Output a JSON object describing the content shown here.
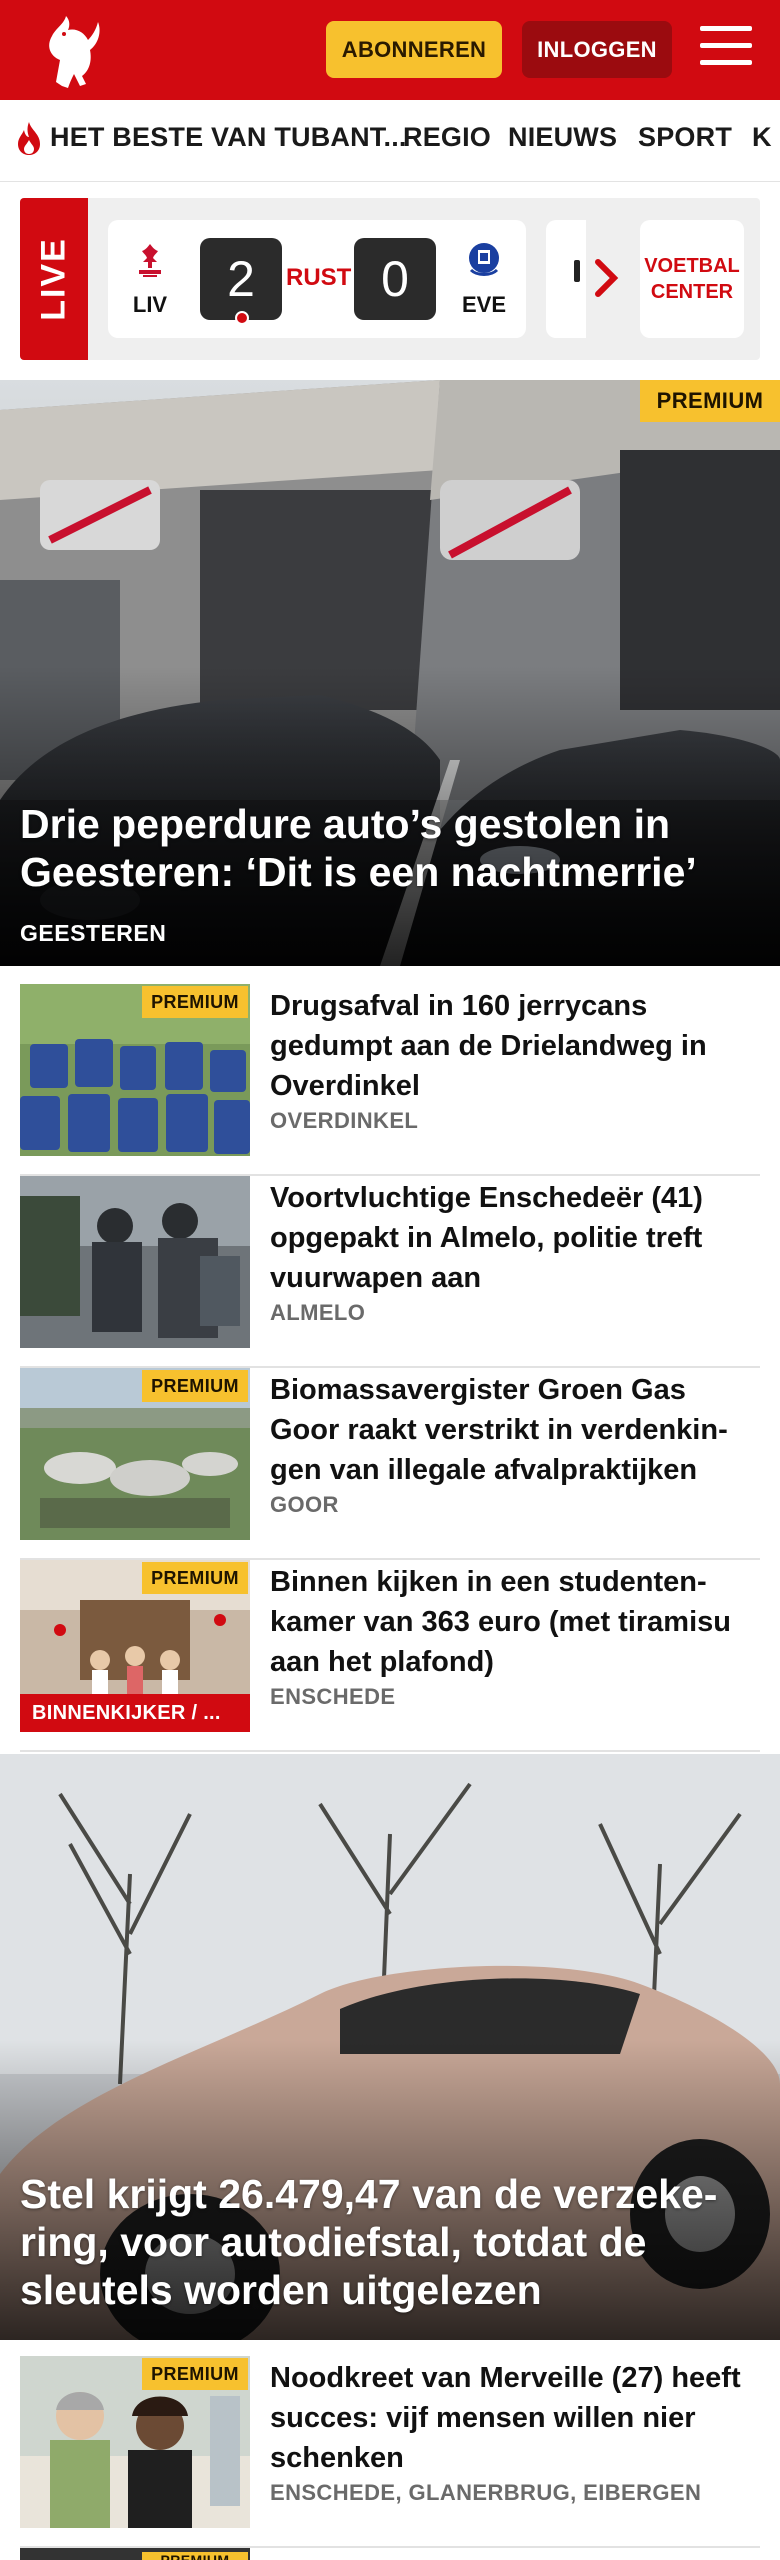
{
  "header": {
    "subscribe_label": "ABONNEREN",
    "login_label": "INLOGGEN",
    "brand_color": "#d10a11",
    "accent_color": "#f7c12e"
  },
  "nav": {
    "items": [
      "HET BESTE VAN TUBANT...",
      "REGIO",
      "NIEUWS",
      "SPORT",
      "K"
    ]
  },
  "live": {
    "label": "LIVE",
    "match": {
      "home": "LIV",
      "home_score": "2",
      "status": "RUST",
      "away_score": "0",
      "away": "EVE"
    },
    "voetbal_center": "VOETBAL CENTER"
  },
  "hero": {
    "badge": "PREMIUM",
    "title": "Drie peperdure auto’s gestolen in Geesteren: ‘Dit is een nachtmerrie’",
    "location": "GEESTEREN"
  },
  "articles": [
    {
      "premium": "PREMIUM",
      "title": "Drugsafval in 160 jerrycans gedumpt aan de Drielandweg in Overdinkel",
      "location": "OVERDINKEL"
    },
    {
      "premium": "",
      "title": "Voortvluchtige Enschedeër (41) opgepakt in Almelo, politie treft vuurwapen aan",
      "location": "ALMELO"
    },
    {
      "premium": "PREMIUM",
      "title": "Biomassavergister Groen Gas Goor raakt verstrikt in verdenkin­gen van illegale afvalpraktijken",
      "location": "GOOR"
    },
    {
      "premium": "PREMIUM",
      "title": "Binnen kijken in een studenten­kamer van 363 euro (met tiramisu aan het plafond)",
      "location": "ENSCHEDE",
      "category": "BINNENKIJKER / ..."
    }
  ],
  "hero2": {
    "title": "Stel krijgt 26.479,47 van de verzeke­ring, voor autodiefstal, totdat de sleutels worden uitgelezen"
  },
  "articles2": [
    {
      "premium": "PREMIUM",
      "title": "Noodkreet van Merveille (27) heeft succes: vijf mensen willen nier schenken",
      "location": "ENSCHEDE, GLANERBRUG, EIBERGEN"
    },
    {
      "premium": "PREMIUM",
      "title": "",
      "location": ""
    }
  ]
}
